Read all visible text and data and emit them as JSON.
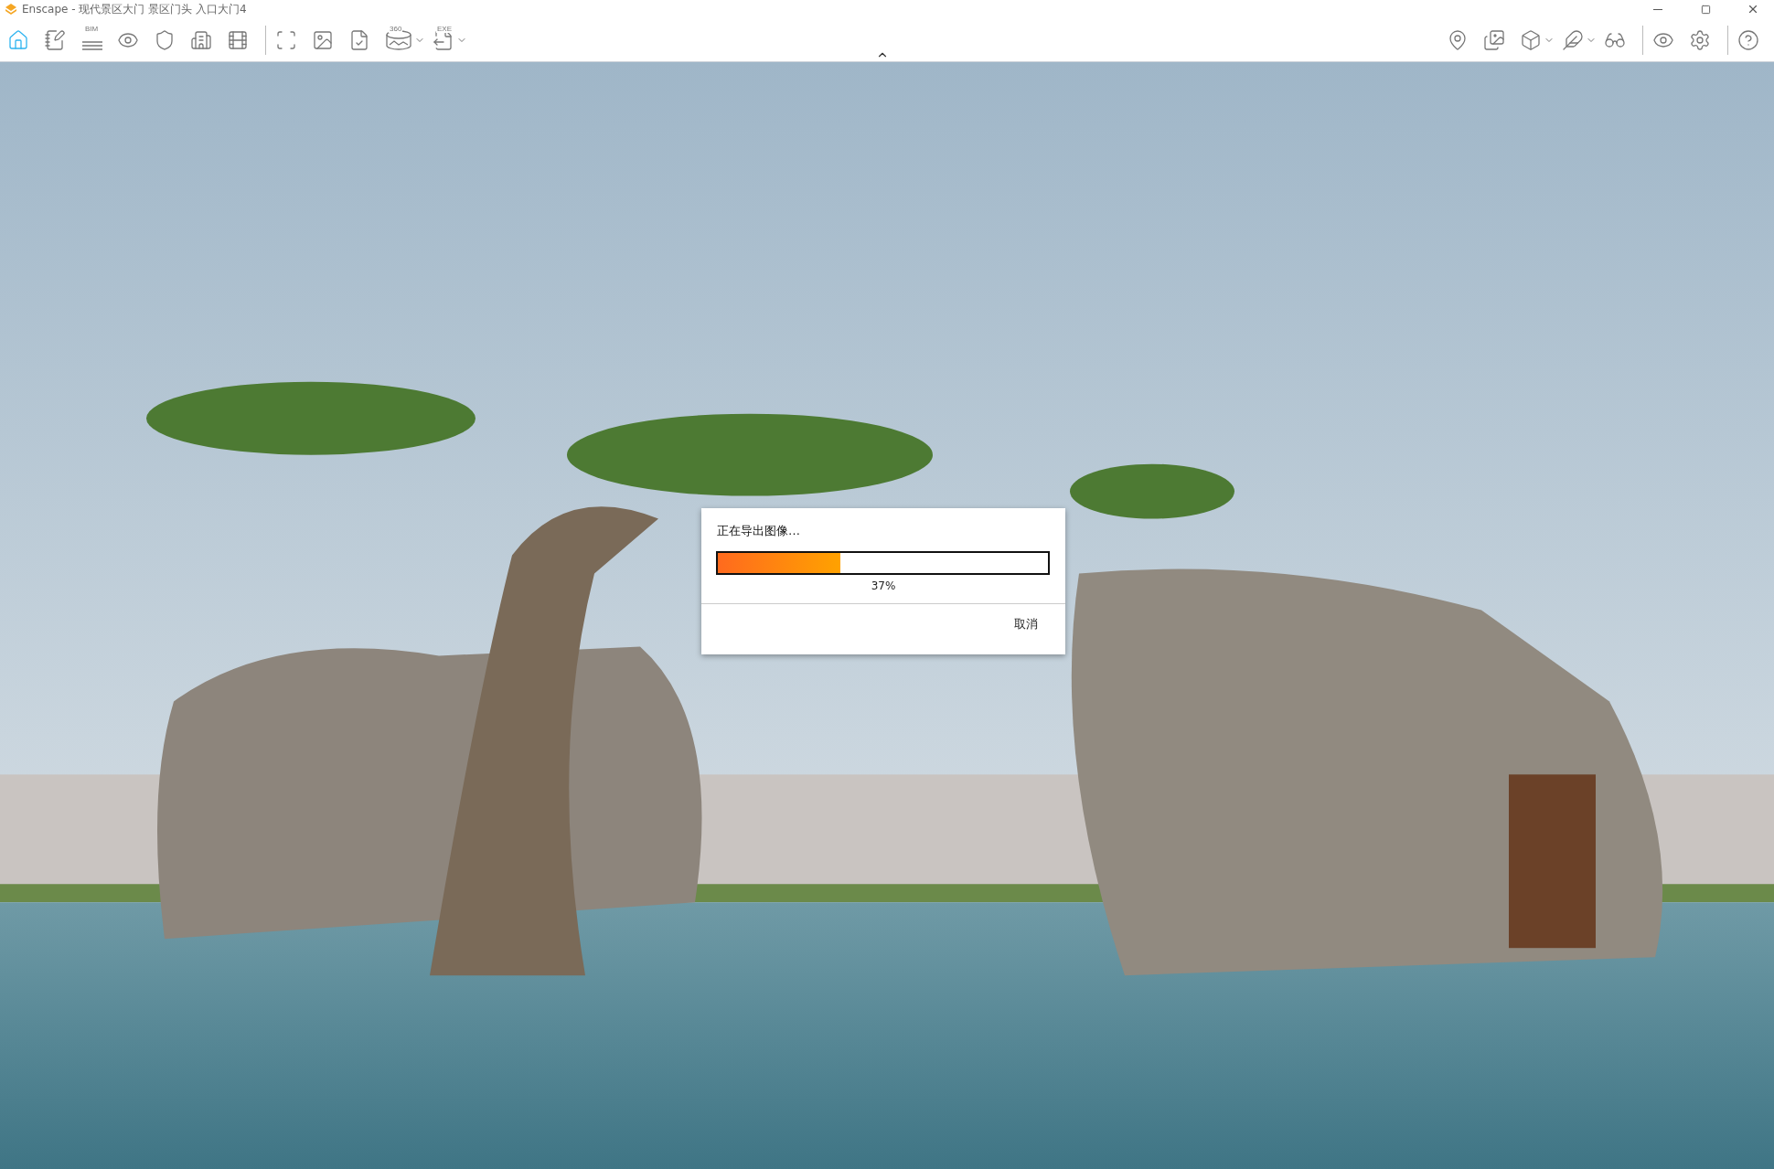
{
  "window": {
    "title": "Enscape - 现代景区大门 景区门头 入口大门4"
  },
  "toolbar": {
    "left": [
      {
        "kind": "home",
        "selected": true
      },
      {
        "kind": "notes",
        "selected": false
      },
      {
        "kind": "bim",
        "badge": "BIM",
        "selected": false
      },
      {
        "kind": "view",
        "selected": false
      },
      {
        "kind": "shield",
        "selected": false
      },
      {
        "kind": "building",
        "selected": false
      },
      {
        "kind": "film",
        "selected": false
      },
      {
        "kind": "divider"
      },
      {
        "kind": "screenshot",
        "selected": false
      },
      {
        "kind": "image",
        "selected": false
      },
      {
        "kind": "file-check",
        "selected": false
      },
      {
        "kind": "pano",
        "badge": "360",
        "menu": true,
        "selected": false
      },
      {
        "kind": "exe",
        "badge": "EXE",
        "menu": true,
        "selected": false
      }
    ],
    "right": [
      {
        "kind": "map",
        "selected": false
      },
      {
        "kind": "panorama",
        "selected": false
      },
      {
        "kind": "cube",
        "menu": true,
        "selected": false
      },
      {
        "kind": "wing",
        "menu": true,
        "selected": false
      },
      {
        "kind": "vr",
        "selected": false
      },
      {
        "kind": "divider"
      },
      {
        "kind": "eye",
        "selected": false
      },
      {
        "kind": "gears",
        "selected": false
      },
      {
        "kind": "divider"
      },
      {
        "kind": "help",
        "selected": false
      }
    ]
  },
  "dialog": {
    "title": "正在导出图像…",
    "level": 0.37,
    "reading": "37%",
    "button": "取消"
  }
}
